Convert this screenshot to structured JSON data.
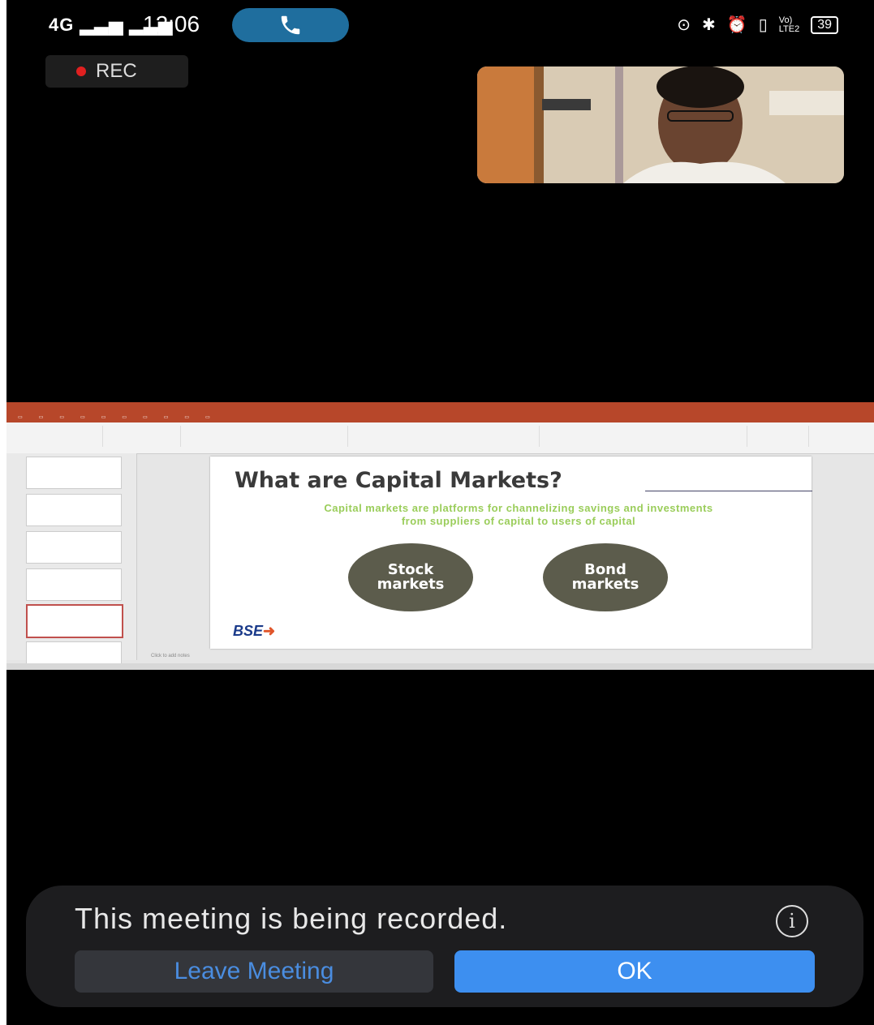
{
  "status_bar": {
    "signal": "4G",
    "time": "12:06",
    "battery": "39"
  },
  "recording_indicator": {
    "label": "REC"
  },
  "shared_screen": {
    "slide": {
      "heading": "What are Capital Markets?",
      "subtitle_line1": "Capital markets are platforms for channelizing savings and investments",
      "subtitle_line2": "from suppliers of capital to users of capital",
      "circle_left": "Stock markets",
      "circle_right": "Bond markets",
      "logo": "BSE"
    },
    "notes_placeholder": "Click to add notes"
  },
  "dialog": {
    "message": "This meeting is being recorded.",
    "leave_label": "Leave Meeting",
    "ok_label": "OK"
  },
  "colors": {
    "ok_button": "#3d8ff0",
    "leave_text": "#4a8de0",
    "ppt_accent": "#b7472a",
    "slide_subtitle": "#9acd5a",
    "circle_fill": "#5c5c4c"
  }
}
